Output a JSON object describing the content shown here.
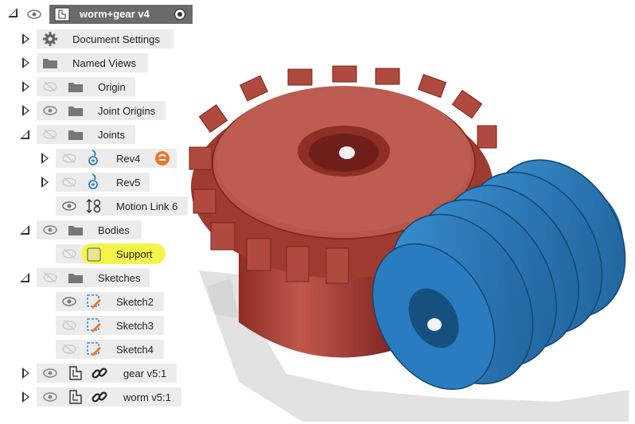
{
  "browser": {
    "root": {
      "label": "worm+gear v4"
    },
    "items": [
      {
        "label": "Document Settings",
        "icon": "gear-icon"
      },
      {
        "label": "Named Views",
        "icon": "folder-icon"
      },
      {
        "label": "Origin",
        "icon": "folder-icon",
        "visible": false
      },
      {
        "label": "Joint Origins",
        "icon": "folder-icon",
        "visible": true
      },
      {
        "label": "Joints",
        "icon": "folder-icon",
        "visible": false
      },
      {
        "label": "Rev4",
        "icon": "revolute-joint-icon",
        "visible": false,
        "badge": "warning-badge-icon"
      },
      {
        "label": "Rev5",
        "icon": "revolute-joint-icon",
        "visible": false
      },
      {
        "label": "Motion Link 6",
        "icon": "motion-link-icon",
        "visible": true
      },
      {
        "label": "Bodies",
        "icon": "folder-icon",
        "visible": true
      },
      {
        "label": "Support",
        "icon": "body-icon",
        "visible": false,
        "highlighted": true
      },
      {
        "label": "Sketches",
        "icon": "folder-icon",
        "visible": false
      },
      {
        "label": "Sketch2",
        "icon": "sketch-icon",
        "visible": true
      },
      {
        "label": "Sketch3",
        "icon": "sketch-icon",
        "visible": false
      },
      {
        "label": "Sketch4",
        "icon": "sketch-icon",
        "visible": false
      },
      {
        "label": "gear v5:1",
        "icon": "linked-component-icon",
        "visible": true
      },
      {
        "label": "worm v5:1",
        "icon": "linked-component-icon",
        "visible": true
      }
    ]
  },
  "colors": {
    "gear": "#b5473c",
    "worm": "#2f7fc0",
    "highlight": "#f3f54a",
    "root_bar": "#6b6b6b",
    "row_bg": "#ececec"
  }
}
